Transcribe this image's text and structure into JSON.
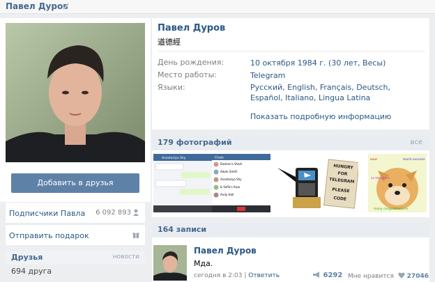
{
  "header": {
    "name": "Павел Дуров"
  },
  "sidebar": {
    "add_friend": "Добавить в друзья",
    "subscribers_label": "Подписчики Павла",
    "subscribers_count": "6 092 893",
    "gift_label": "Отправить подарок",
    "friends_title": "Друзья",
    "friends_news": "новости",
    "friends_count": "694 друга"
  },
  "profile": {
    "name": "Павел Дуров",
    "status": "道德經",
    "info": [
      {
        "label": "День рождения:",
        "value": "10 октября 1984 г. (30 лет, Весы)"
      },
      {
        "label": "Место работы:",
        "value": "Telegram"
      },
      {
        "label": "Языки:",
        "value": "Русский, English, Français, Deutsch, Español, Italiano, Lingua Latina"
      }
    ],
    "more": "Показать подробную информацию"
  },
  "photos": {
    "title": "179 фотографий",
    "all": "все",
    "items": [
      {
        "chat_title": "Anastasiya Shy",
        "rows": [
          "Damien's Shark",
          "Adam Smith",
          "Anastasiya Shy",
          "Andy Hall"
        ]
      },
      {
        "chat_title": "Chats",
        "rows": [
          "Damien's Shark",
          "Adam Smith",
          "Anastasiya Shy",
          "& Sofia's Arpo",
          "Andy Hall"
        ]
      },
      {
        "sign_lines": [
          "HUNGRY",
          "FOR",
          "TELEGRAM",
          "PLEASE",
          "CODE"
        ]
      },
      {
        "captions": [
          "wow",
          "much success",
          "so telegram",
          "many congratulations"
        ]
      }
    ]
  },
  "posts": {
    "title": "164 записи",
    "items": [
      {
        "author": "Павел Дуров",
        "text": "Мда.",
        "time": "сегодня в 2:03",
        "reply": "Ответить",
        "shares": "6292",
        "likes_label": "Мне нравится",
        "likes": "27046"
      }
    ]
  }
}
